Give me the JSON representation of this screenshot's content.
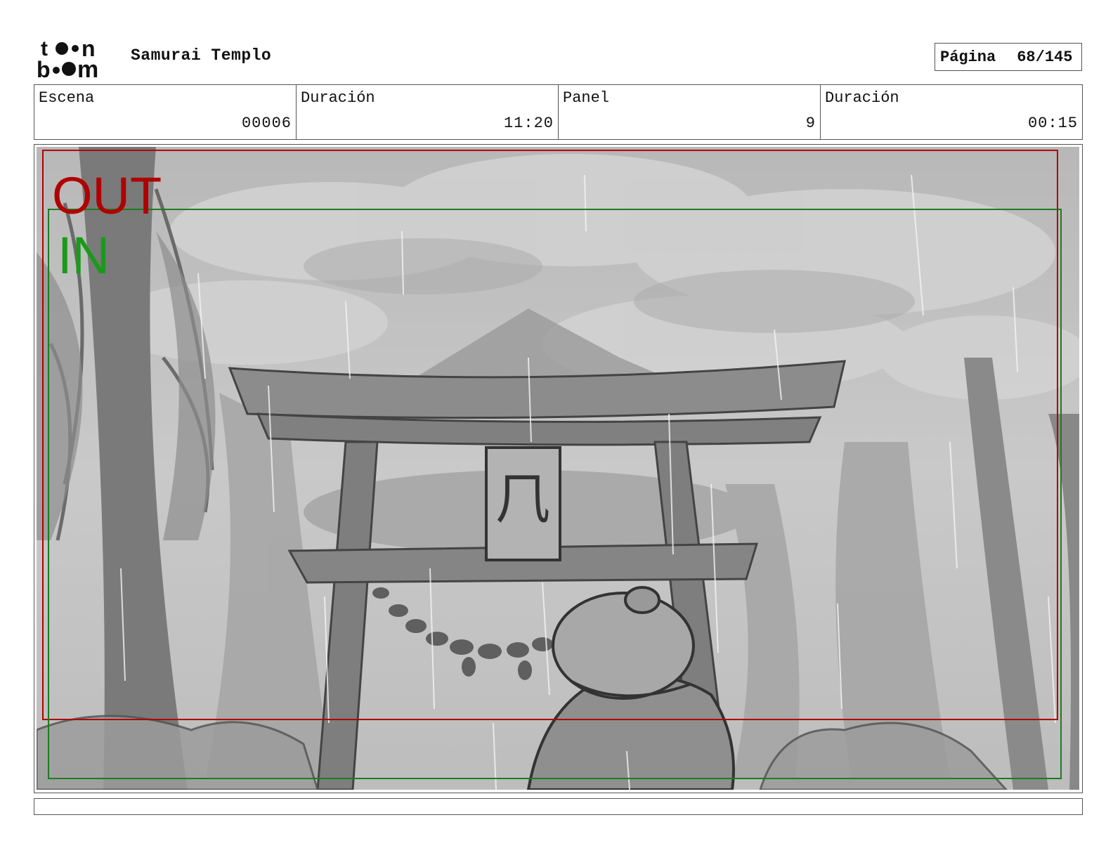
{
  "header": {
    "logo_label": "toon boom",
    "project_title": "Samurai Templo",
    "page_label": "Página",
    "page_value": "68/145"
  },
  "info": {
    "scene_label": "Escena",
    "scene_value": "00006",
    "scene_duration_label": "Duración",
    "scene_duration_value": "11:20",
    "panel_label": "Panel",
    "panel_value": "9",
    "panel_duration_label": "Duración",
    "panel_duration_value": "00:15"
  },
  "panel": {
    "out_label": "OUT",
    "in_label": "IN",
    "gate_sign": "𠘨",
    "out_color": "#b00000",
    "in_color": "#1a9a1a"
  },
  "notes": {
    "text": ""
  }
}
